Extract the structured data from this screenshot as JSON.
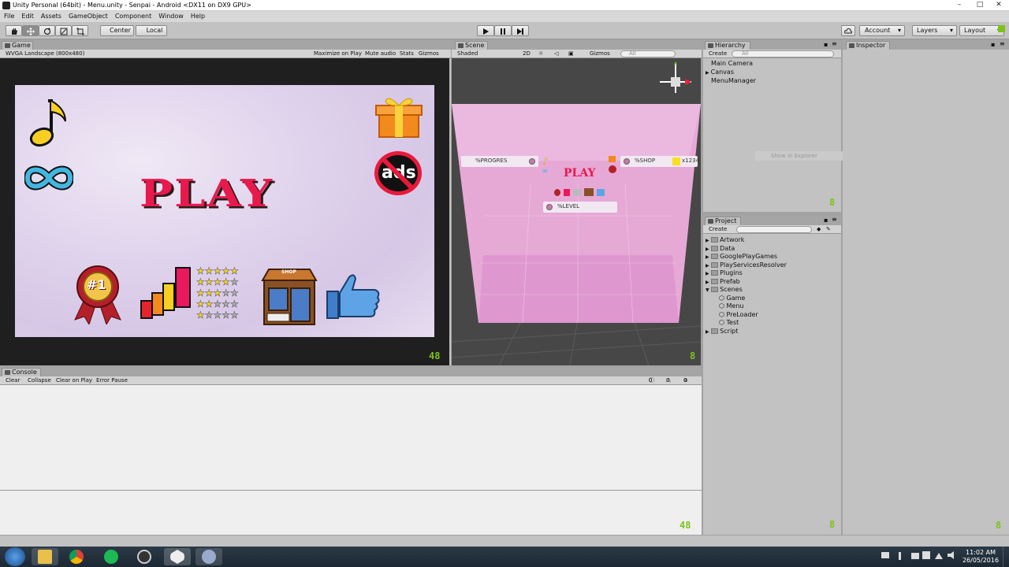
{
  "window": {
    "title": "Unity Personal (64bit) - Menu.unity - Senpai - Android <DX11 on DX9 GPU>",
    "minimize": "–",
    "maximize": "□",
    "close": "✕"
  },
  "menu": [
    "File",
    "Edit",
    "Assets",
    "GameObject",
    "Component",
    "Window",
    "Help"
  ],
  "toolbar": {
    "center_label": "Center",
    "local_label": "Local",
    "account_label": "Account",
    "layers_label": "Layers",
    "layout_label": "Layout"
  },
  "game": {
    "tab_label": "Game",
    "resolution": "WVGA Landscape (800x480)",
    "maximize_on_play": "Maximize on Play",
    "mute_audio": "Mute audio",
    "stats": "Stats",
    "gizmos": "Gizmos",
    "play_text": "PLAY",
    "ads_text": "ads",
    "shop_sign": "SHOP",
    "medal_text": "#1",
    "counter": "48"
  },
  "scene": {
    "tab_label": "Scene",
    "shading": "Shaded",
    "mode_2d": "2D",
    "gizmos": "Gizmos",
    "search_placeholder": "All",
    "progress_label": "%PROGRES",
    "shop_label": "%SHOP",
    "coins_label": "x1234",
    "level_label": "%LEVEL",
    "play_text": "PLAY",
    "counter": "8"
  },
  "hierarchy": {
    "tab_label": "Hierarchy",
    "create_label": "Create",
    "search_placeholder": "All",
    "items": [
      "Main Camera",
      "Canvas",
      "MenuManager"
    ],
    "tooltip": "Show in Explorer",
    "counter": "8"
  },
  "project": {
    "tab_label": "Project",
    "create_label": "Create",
    "folders": [
      "Artwork",
      "Data",
      "GooglePlayGames",
      "PlayServicesResolver",
      "Plugins",
      "Prefab",
      "Scenes"
    ],
    "scenes": [
      "Game",
      "Menu",
      "PreLoader",
      "Test"
    ],
    "last_folder": "Script",
    "counter": "8"
  },
  "inspector": {
    "tab_label": "Inspector",
    "counter": "8"
  },
  "console": {
    "tab_label": "Console",
    "buttons": [
      "Clear",
      "Collapse",
      "Clear on Play",
      "Error Pause"
    ],
    "log_count": "0",
    "warn_count": "0",
    "error_count": "0",
    "counter": "48"
  },
  "taskbar": {
    "time": "11:02 AM",
    "date": "26/05/2016"
  },
  "colors": {
    "play_red": "#e8194d",
    "accent_green": "#7cc21a",
    "panel_gray": "#c2c2c2"
  }
}
